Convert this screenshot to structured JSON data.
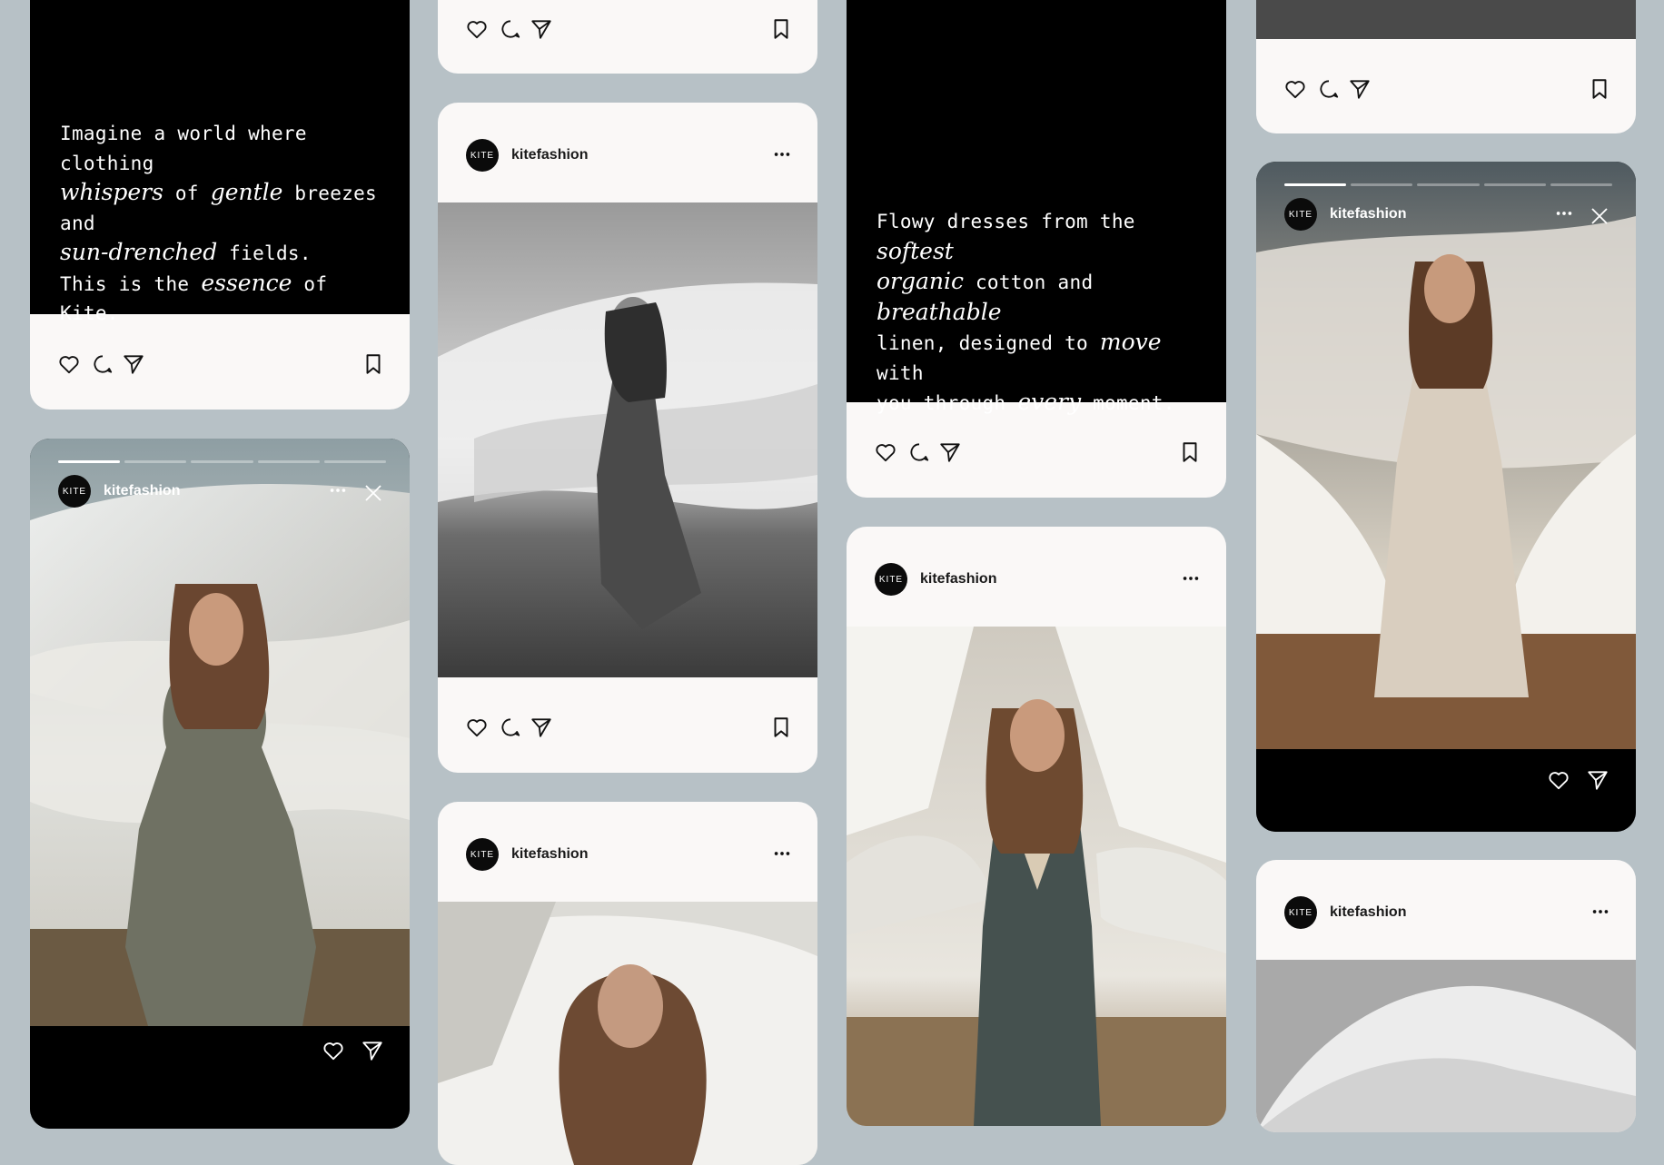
{
  "brand": {
    "avatar_text": "KITE",
    "username": "kitefashion"
  },
  "quotes": {
    "q1": {
      "l1": "Imagine a world where clothing",
      "l2_it1": "whispers",
      "l2_t1": " of ",
      "l2_it2": "gentle",
      "l2_t2": " breezes and",
      "l3_it": "sun-drenched",
      "l3_t": " fields.",
      "l4_t1": "This is the ",
      "l4_it": "essence",
      "l4_t2": " of Kite."
    },
    "q2": {
      "l1_t": "Flowy dresses from the ",
      "l1_it": "softest",
      "l2_it1": "organic",
      "l2_t": " cotton and ",
      "l2_it2": "breathable",
      "l3_t1": "linen, designed to ",
      "l3_it": "move",
      "l3_t2": " with",
      "l4_t1": "you through ",
      "l4_it": "every",
      "l4_t2": " moment."
    }
  },
  "icons": [
    "heart-icon",
    "comment-icon",
    "share-icon",
    "bookmark-icon",
    "more-icon",
    "close-icon"
  ],
  "colors": {
    "background": "#b7c1c6",
    "card": "#faf8f7",
    "black": "#000000"
  }
}
